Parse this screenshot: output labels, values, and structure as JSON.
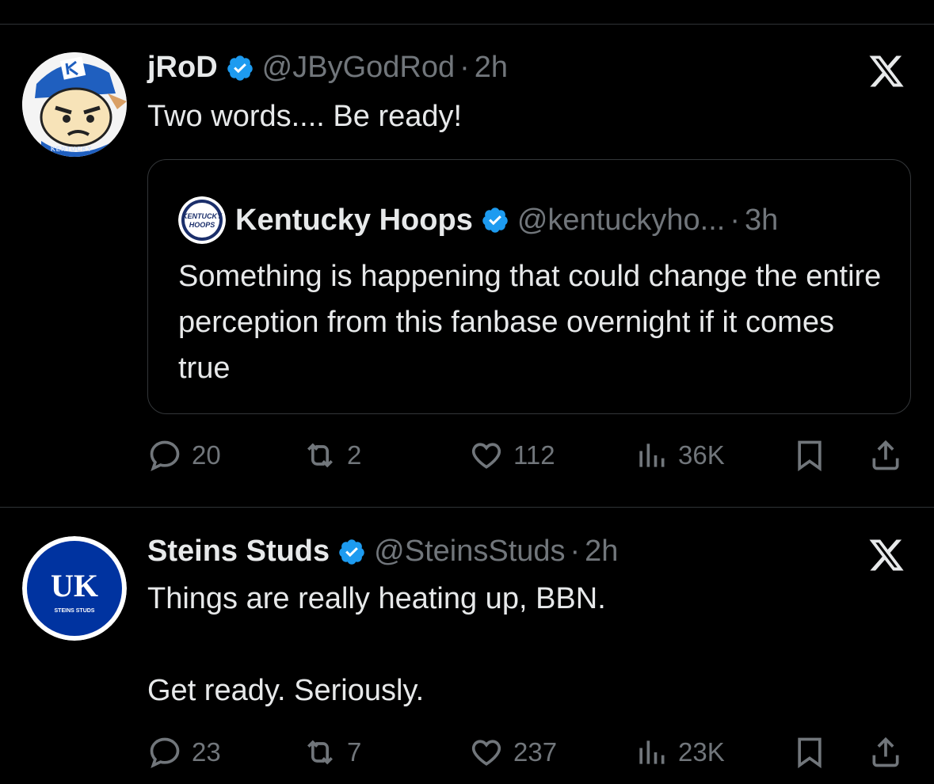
{
  "tweets": [
    {
      "name": "jRoD",
      "handle": "@JByGodRod",
      "separator": "·",
      "time": "2h",
      "text": "Two words.... Be ready!",
      "quote": {
        "name": "Kentucky Hoops",
        "handle": "@kentuckyho...",
        "separator": "·",
        "time": "3h",
        "text": "Something is happening that could change the entire perception from this fanbase overnight if it comes true",
        "avatar_text_line1": "KENTUCKY",
        "avatar_text_line2": "HOOPS"
      },
      "avatar_text": "KENTUCKY",
      "stats": {
        "replies": "20",
        "reposts": "2",
        "likes": "112",
        "views": "36K"
      }
    },
    {
      "name": "Steins Studs",
      "handle": "@SteinsStuds",
      "separator": "·",
      "time": "2h",
      "text": "Things are really heating up, BBN.\n\nGet ready. Seriously.",
      "avatar_text": "STEINS STUDS",
      "avatar_logo": "UK",
      "stats": {
        "replies": "23",
        "reposts": "7",
        "likes": "237",
        "views": "23K"
      }
    }
  ],
  "colors": {
    "background": "#000000",
    "text": "#e7e9ea",
    "muted": "#71767b",
    "verified": "#1d9bf0",
    "uk_blue": "#0033a0"
  },
  "icons": [
    "verified-badge-icon",
    "x-logo-icon",
    "reply-icon",
    "repost-icon",
    "like-icon",
    "views-icon",
    "bookmark-icon",
    "share-icon"
  ]
}
